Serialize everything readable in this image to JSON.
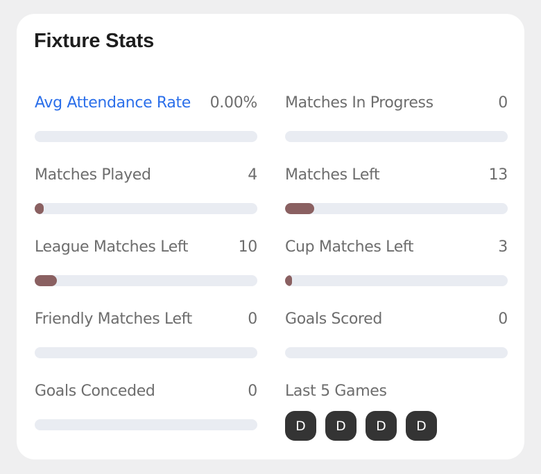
{
  "card": {
    "title": "Fixture Stats",
    "accent_blue": "#2b6fea",
    "bar_fill_color": "#8a6061",
    "bar_track_color": "#e9ecf2",
    "badge_color": "#343434",
    "label_color": "#6d6d6d",
    "background": "#ffffff",
    "page_background": "#efeff0"
  },
  "stats": [
    {
      "label": "Avg Attendance Rate",
      "value": "0.00%",
      "percent": 0,
      "is_link": true,
      "type": "bar"
    },
    {
      "label": "Matches In Progress",
      "value": "0",
      "percent": 0,
      "is_link": false,
      "type": "bar"
    },
    {
      "label": "Matches Played",
      "value": "4",
      "percent": 4,
      "is_link": false,
      "type": "bar"
    },
    {
      "label": "Matches Left",
      "value": "13",
      "percent": 13,
      "is_link": false,
      "type": "bar"
    },
    {
      "label": "League Matches Left",
      "value": "10",
      "percent": 10,
      "is_link": false,
      "type": "bar"
    },
    {
      "label": "Cup Matches Left",
      "value": "3",
      "percent": 3,
      "is_link": false,
      "type": "bar"
    },
    {
      "label": "Friendly Matches Left",
      "value": "0",
      "percent": 0,
      "is_link": false,
      "type": "bar"
    },
    {
      "label": "Goals Scored",
      "value": "0",
      "percent": 0,
      "is_link": false,
      "type": "bar"
    },
    {
      "label": "Goals Conceded",
      "value": "0",
      "percent": 0,
      "is_link": false,
      "type": "bar"
    },
    {
      "label": "Last 5 Games",
      "value": "",
      "is_link": false,
      "type": "games",
      "results": [
        "D",
        "D",
        "D",
        "D"
      ]
    }
  ]
}
